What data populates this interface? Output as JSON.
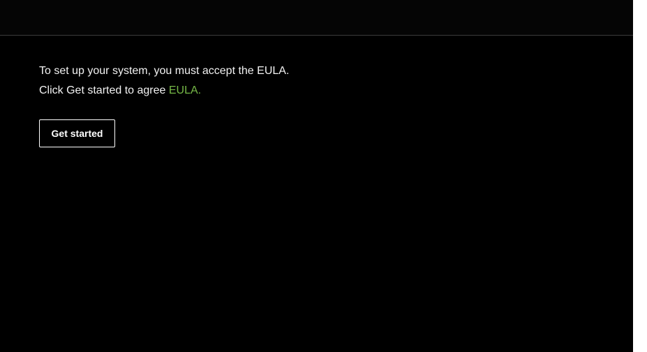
{
  "eula_screen": {
    "line1": "To set up your system, you must accept the EULA.",
    "line2_prefix": "Click Get started to agree",
    "eula_link_text": "EULA.",
    "get_started_label": "Get started"
  },
  "colors": {
    "background": "#000000",
    "text": "#f2f2f2",
    "link": "#76b947",
    "divider": "#3c3c3c"
  }
}
